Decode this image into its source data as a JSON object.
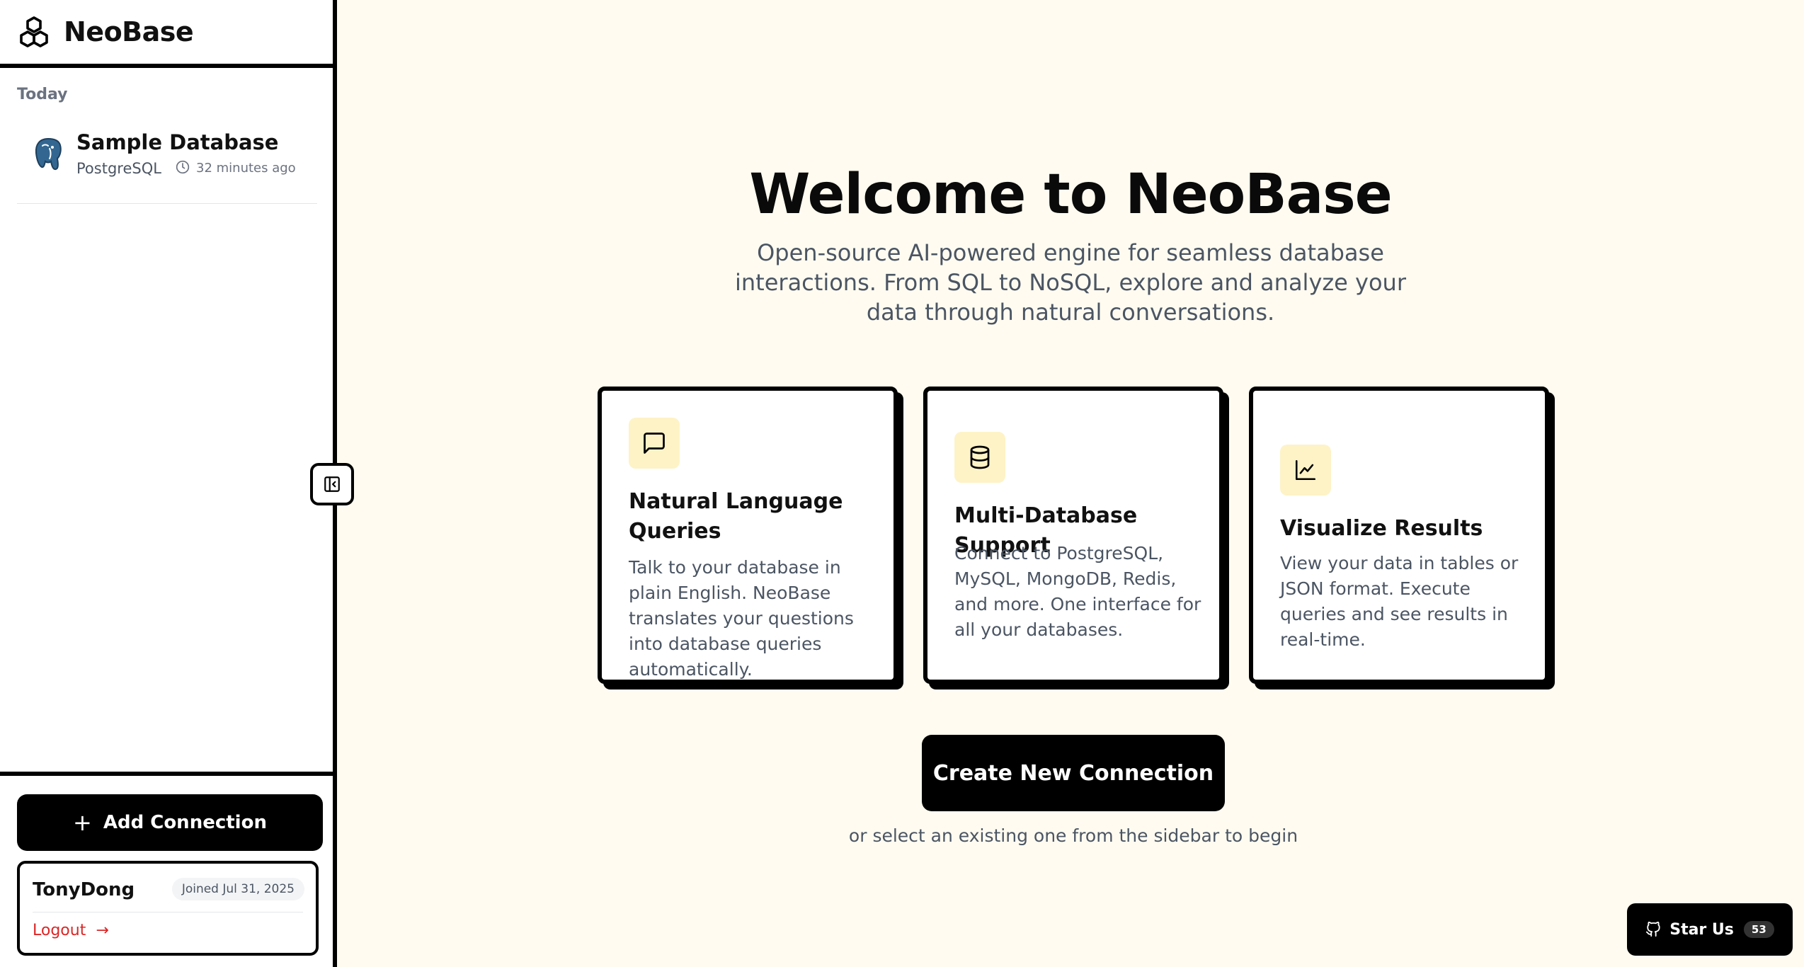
{
  "app": {
    "name": "NeoBase"
  },
  "sidebar": {
    "section_label": "Today",
    "connections": [
      {
        "name": "Sample Database",
        "type": "PostgreSQL",
        "time": "32 minutes ago",
        "icon": "postgresql-icon"
      }
    ],
    "add_button_label": "Add Connection",
    "user": {
      "name": "TonyDong",
      "joined": "Joined Jul 31, 2025",
      "logout_label": "Logout"
    }
  },
  "main": {
    "title": "Welcome to NeoBase",
    "subtitle": "Open-source AI-powered engine for seamless database interactions. From SQL to NoSQL, explore and analyze your data through natural conversations.",
    "features": [
      {
        "icon": "message-square-icon",
        "title": "Natural Language Queries",
        "description": "Talk to your database in plain English. NeoBase translates your questions into database queries automatically."
      },
      {
        "icon": "database-icon",
        "title": "Multi-Database Support",
        "description": "Connect to PostgreSQL, MySQL, MongoDB, Redis, and more. One interface for all your databases."
      },
      {
        "icon": "line-chart-icon",
        "title": "Visualize Results",
        "description": "View your data in tables or JSON format. Execute queries and see results in real-time."
      }
    ],
    "create_button_label": "Create New Connection",
    "hint": "or select an existing one from the sidebar to begin"
  },
  "star": {
    "label": "Star Us",
    "count": "53"
  },
  "colors": {
    "background": "#FFFBF0",
    "accent": "#000000",
    "icon_bg": "#FEF3C7",
    "logout": "#DC2626"
  }
}
